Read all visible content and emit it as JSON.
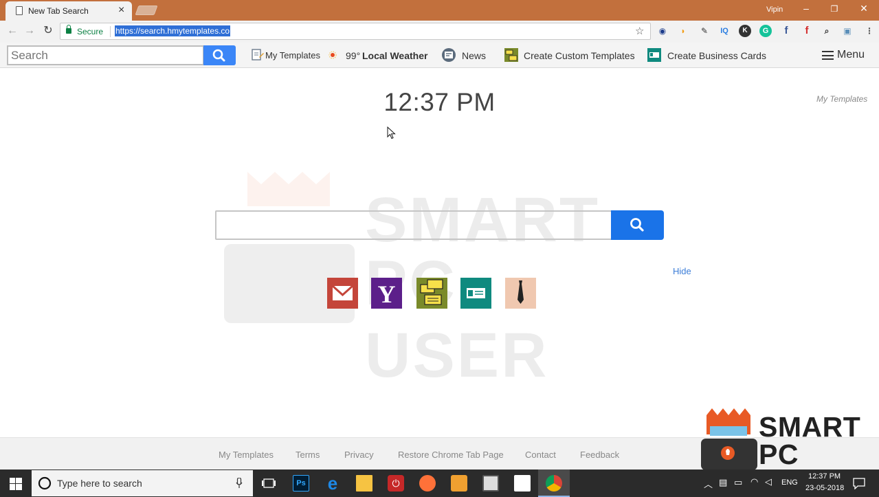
{
  "browser": {
    "tab_title": "New Tab Search",
    "profile_name": "Vipin",
    "secure_label": "Secure",
    "url": "https://search.hmytemplates.co"
  },
  "toolbar": {
    "search_placeholder": "Search",
    "my_templates": "My Templates",
    "weather_temp": "99°",
    "weather_label": "Local Weather",
    "news": "News",
    "custom_templates": "Create Custom Templates",
    "business_cards": "Create Business Cards",
    "menu": "Menu"
  },
  "main": {
    "clock": "12:37 PM",
    "corner_link": "My Templates",
    "hide_link": "Hide",
    "tiles": [
      {
        "name": "gmail",
        "color": "#c4453a"
      },
      {
        "name": "yahoo",
        "color": "#5c1f8a"
      },
      {
        "name": "templates",
        "color": "#7a8a2a"
      },
      {
        "name": "business-cards",
        "color": "#0f8a7f"
      },
      {
        "name": "tie",
        "color": "#f0c8b0"
      }
    ]
  },
  "footer": {
    "links": [
      "My Templates",
      "Terms",
      "Privacy",
      "Restore Chrome Tab Page",
      "Contact",
      "Feedback"
    ]
  },
  "brand": {
    "line1": "SMART",
    "line2": "PC USER"
  },
  "taskbar": {
    "search_placeholder": "Type here to search",
    "language": "ENG",
    "time": "12:37 PM",
    "date": "23-05-2018"
  },
  "colors": {
    "titlebar": "#c2703d",
    "search_blue": "#1a73e8",
    "toolbar_search_blue": "#3b86f7",
    "link_blue": "#3b7dd8",
    "brand_orange": "#e85a25"
  }
}
